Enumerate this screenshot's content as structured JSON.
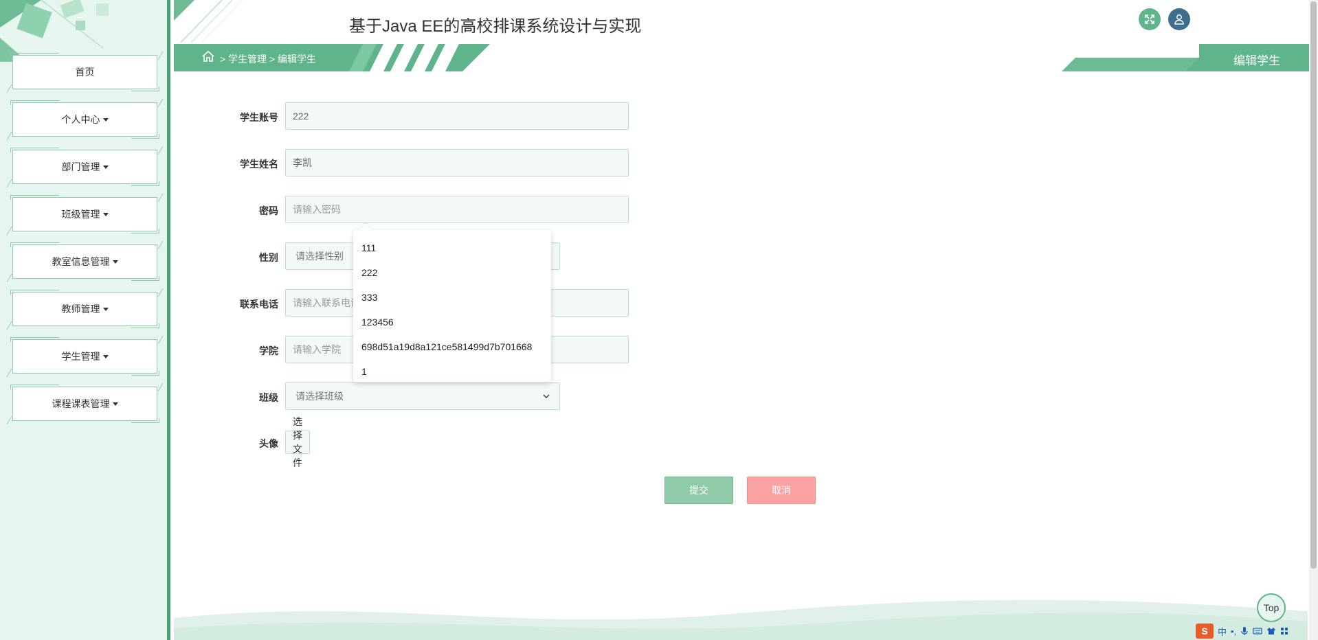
{
  "header": {
    "title": "基于Java EE的高校排课系统设计与实现"
  },
  "breadcrumb": {
    "path": "> 学生管理 > 编辑学生",
    "page_title": "编辑学生"
  },
  "sidebar": {
    "items": [
      {
        "label": "首页",
        "has_caret": false
      },
      {
        "label": "个人中心",
        "has_caret": true
      },
      {
        "label": "部门管理",
        "has_caret": true
      },
      {
        "label": "班级管理",
        "has_caret": true
      },
      {
        "label": "教室信息管理",
        "has_caret": true
      },
      {
        "label": "教师管理",
        "has_caret": true
      },
      {
        "label": "学生管理",
        "has_caret": true
      },
      {
        "label": "课程课表管理",
        "has_caret": true
      }
    ]
  },
  "form": {
    "account": {
      "label": "学生账号",
      "value": "222"
    },
    "name": {
      "label": "学生姓名",
      "value": "李凯"
    },
    "password": {
      "label": "密码",
      "placeholder": "请输入密码",
      "value": ""
    },
    "gender": {
      "label": "性别",
      "placeholder": "请选择性别"
    },
    "phone": {
      "label": "联系电话",
      "placeholder": "请输入联系电话"
    },
    "college": {
      "label": "学院",
      "placeholder": "请输入学院"
    },
    "class": {
      "label": "班级",
      "placeholder": "请选择班级"
    },
    "avatar": {
      "label": "头像",
      "button": "选择文件"
    },
    "submit": "提交",
    "cancel": "取消"
  },
  "autocomplete": {
    "options": [
      "111",
      "222",
      "333",
      "123456",
      "698d51a19d8a121ce581499d7b701668",
      "1"
    ]
  },
  "top_button": "Top",
  "ime": {
    "logo": "S",
    "mode": "中"
  },
  "colors": {
    "primary": "#5fb48c",
    "sidebar_bg": "#e6f5ee",
    "cancel": "#fba2a2",
    "user_btn": "#3f6e8c"
  }
}
